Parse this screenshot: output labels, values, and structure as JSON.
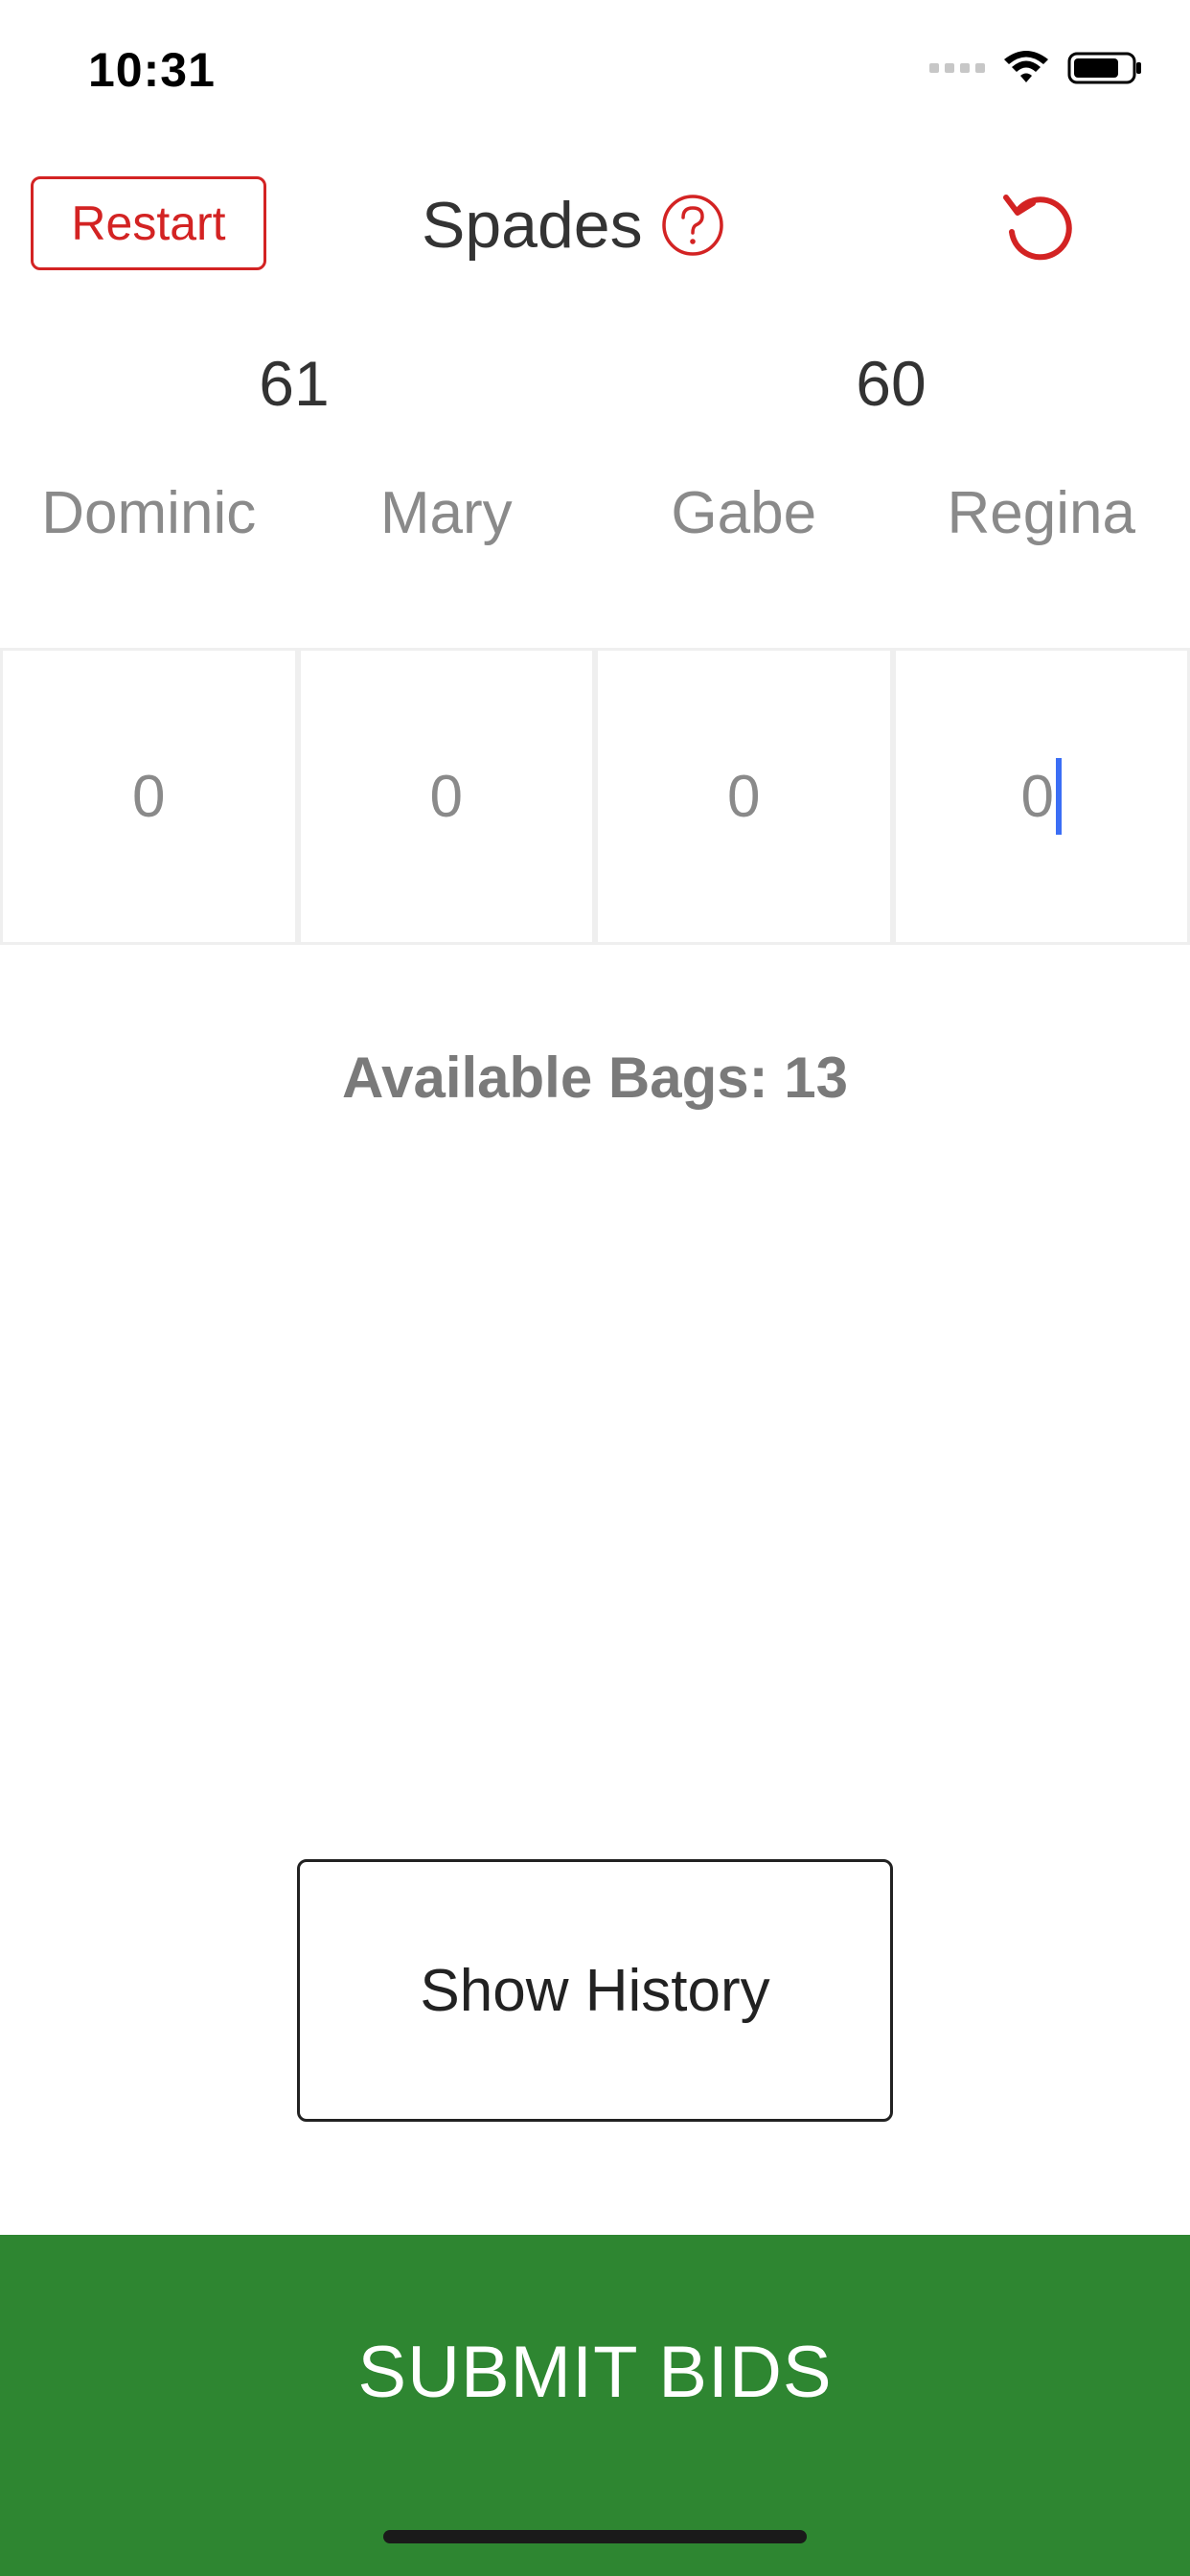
{
  "status_bar": {
    "time": "10:31"
  },
  "header": {
    "restart_label": "Restart",
    "title": "Spades",
    "help_icon": "question-circle-icon",
    "undo_icon": "undo-icon"
  },
  "scores": {
    "team1": "61",
    "team2": "60"
  },
  "players": [
    {
      "name": "Dominic",
      "bid": "0"
    },
    {
      "name": "Mary",
      "bid": "0"
    },
    {
      "name": "Gabe",
      "bid": "0"
    },
    {
      "name": "Regina",
      "bid": "0"
    }
  ],
  "bags_label": "Available Bags: 13",
  "history_label": "Show History",
  "submit_label": "SUBMIT BIDS",
  "colors": {
    "accent_red": "#d32323",
    "submit_green": "#2e8631",
    "caret_blue": "#3b6ef5"
  }
}
